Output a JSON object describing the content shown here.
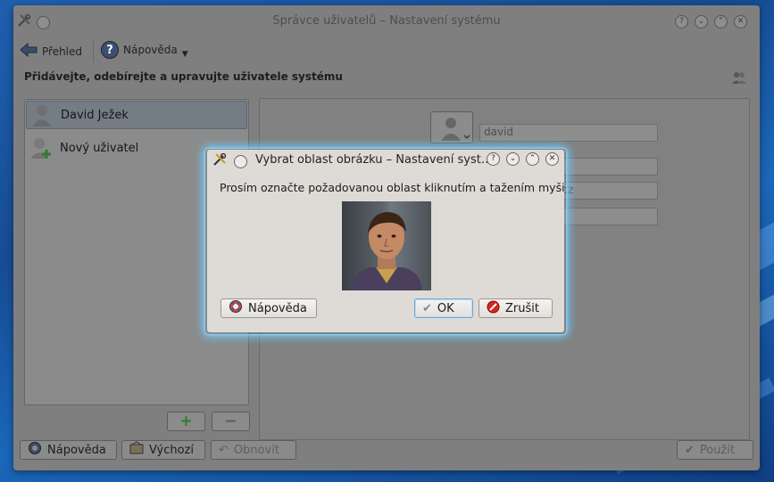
{
  "window": {
    "title": "Správce uživatelů – Nastavení systému",
    "toolbar": {
      "back_label": "Přehled",
      "help_label": "Nápověda"
    },
    "header": "Přidávejte, odebírejte a upravujte uživatele systému",
    "users": [
      {
        "name": "David Ježek",
        "selected": true
      },
      {
        "name": "Nový uživatel",
        "selected": false
      }
    ],
    "fields": {
      "username": "david",
      "email_partial": "d.cz"
    },
    "bottom_buttons": {
      "help": "Nápověda",
      "defaults": "Výchozí",
      "reset": "Obnovit",
      "apply": "Použít"
    }
  },
  "dialog": {
    "title": "Vybrat oblast obrázku – Nastavení syst…",
    "message": "Prosím označte požadovanou oblast kliknutím a tažením myši:",
    "buttons": {
      "help": "Nápověda",
      "ok": "OK",
      "cancel": "Zrušit"
    }
  },
  "colors": {
    "glow": "#6ecbff",
    "desktop": "#1f5fae"
  }
}
